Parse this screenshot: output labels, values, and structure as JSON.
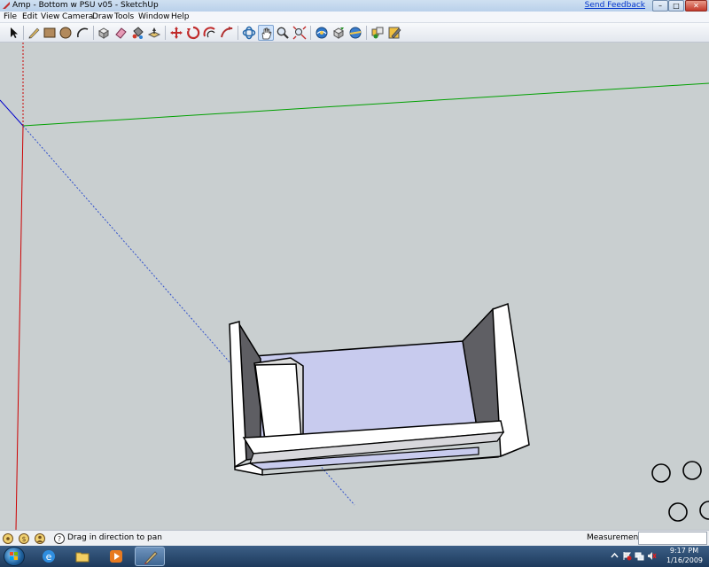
{
  "window": {
    "title": "Amp - Bottom w PSU v05 - SketchUp",
    "send_feedback": "Send Feedback",
    "min_glyph": "–",
    "max_glyph": "□",
    "close_glyph": "✕"
  },
  "menu": [
    "File",
    "Edit",
    "View",
    "Camera",
    "Draw",
    "Tools",
    "Window",
    "Help"
  ],
  "toolbar": [
    {
      "icon": "select-arrow-icon"
    },
    {
      "icon": "pencil-line-icon"
    },
    {
      "icon": "rectangle-icon"
    },
    {
      "icon": "circle-icon"
    },
    {
      "icon": "arc-icon"
    },
    {
      "icon": "make-component-icon"
    },
    {
      "icon": "eraser-icon"
    },
    {
      "icon": "paint-bucket-icon"
    },
    {
      "icon": "push-pull-icon"
    },
    {
      "icon": "move-icon"
    },
    {
      "icon": "rotate-icon"
    },
    {
      "icon": "offset-icon"
    },
    {
      "icon": "orbit-icon"
    },
    {
      "icon": "pan-hand-icon",
      "active": true
    },
    {
      "icon": "zoom-icon"
    },
    {
      "icon": "zoom-extents-icon"
    },
    {
      "icon": "previous-view-icon"
    },
    {
      "icon": "get-models-icon"
    },
    {
      "icon": "share-model-icon"
    },
    {
      "icon": "components-icon"
    },
    {
      "icon": "styles-icon"
    }
  ],
  "status": {
    "hint": "Drag in direction to pan",
    "measurements_label": "Measurements",
    "measurements_value": ""
  },
  "taskbar": {
    "apps": [
      "internet-explorer-icon",
      "folder-icon",
      "media-player-icon",
      "sketchup-icon"
    ],
    "time": "9:17 PM",
    "date": "1/16/2009"
  },
  "colors": {
    "viewport_bg": "#c9cfd0",
    "face_inner": "#c8cbee",
    "axis_red": "#cc0000",
    "axis_green": "#00aa00",
    "axis_blue": "#0000cc"
  }
}
